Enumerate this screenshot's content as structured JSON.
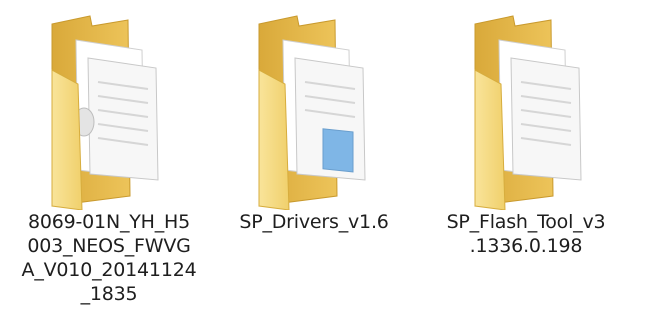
{
  "folders": [
    {
      "name": "8069-01N_YH_H5\n003_NEOS_FWVG\nA_V010_20141124\n_1835",
      "icon": "folder-icon"
    },
    {
      "name": "SP_Drivers_v1.6",
      "icon": "folder-icon"
    },
    {
      "name": "SP_Flash_Tool_v3\n.1336.0.198",
      "icon": "folder-icon"
    }
  ],
  "colors": {
    "folder_back": "#e3b84a",
    "folder_front": "#f6dc84",
    "paper": "#ffffff",
    "paper_shade": "#e8e8e8",
    "label_text": "#1e1e1e"
  }
}
